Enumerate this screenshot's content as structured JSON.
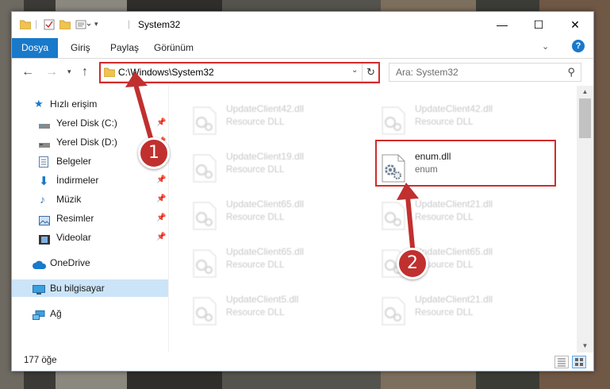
{
  "window": {
    "title": "System32",
    "controls": {
      "minimize": "—",
      "maximize": "☐",
      "close": "✕"
    }
  },
  "ribbon": {
    "file_tab": "Dosya",
    "tabs": [
      "Giriş",
      "Paylaş",
      "Görünüm"
    ]
  },
  "navigation": {
    "address": "C:\\Windows\\System32",
    "search_placeholder": "Ara: System32"
  },
  "sidebar": {
    "quick_access": "Hızlı erişim",
    "items": [
      {
        "label": "Yerel Disk (C:)",
        "icon": "drive-icon"
      },
      {
        "label": "Yerel Disk (D:)",
        "icon": "drive-icon"
      },
      {
        "label": "Belgeler",
        "icon": "documents-icon"
      },
      {
        "label": "İndirmeler",
        "icon": "downloads-icon"
      },
      {
        "label": "Müzik",
        "icon": "music-icon"
      },
      {
        "label": "Resimler",
        "icon": "pictures-icon"
      },
      {
        "label": "Videolar",
        "icon": "videos-icon"
      }
    ],
    "onedrive": "OneDrive",
    "this_pc": "Bu bilgisayar",
    "network": "Ağ"
  },
  "files": {
    "left": [
      {
        "name": "UpdateClient42.dll",
        "type": "Resource DLL"
      },
      {
        "name": "UpdateClient19.dll",
        "type": "Resource DLL"
      },
      {
        "name": "UpdateClient65.dll",
        "type": "Resource DLL"
      },
      {
        "name": "UpdateClient65.dll",
        "type": "Resource DLL"
      },
      {
        "name": "UpdateClient5.dll",
        "type": "Resource DLL"
      }
    ],
    "right": [
      {
        "name": "UpdateClient42.dll",
        "type": "Resource DLL"
      },
      {
        "name": "enum.dll",
        "type": "enum"
      },
      {
        "name": "UpdateClient21.dll",
        "type": "Resource DLL"
      },
      {
        "name": "UpdateClient65.dll",
        "type": "Resource DLL"
      },
      {
        "name": "UpdateClient21.dll",
        "type": "Resource DLL"
      }
    ]
  },
  "status": {
    "item_count": "177 öğe"
  },
  "callouts": {
    "first": "1",
    "second": "2"
  },
  "colors": {
    "accent": "#1979ca",
    "highlight": "#d22b2b",
    "badge": "#c0302f",
    "selection": "#cce4f7"
  }
}
